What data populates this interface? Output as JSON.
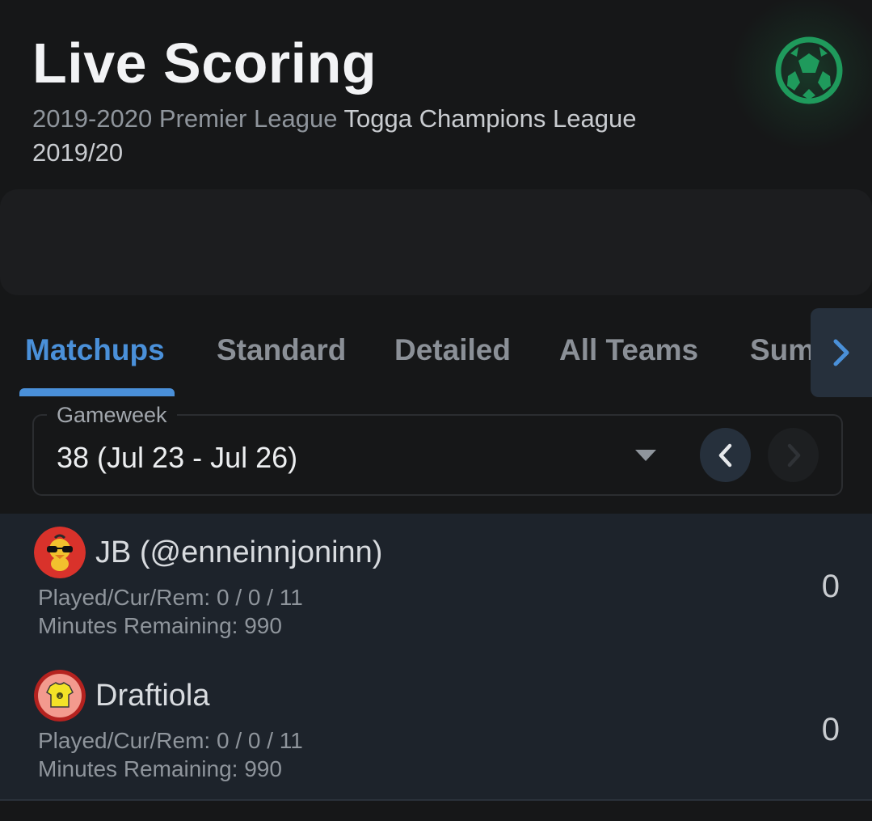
{
  "header": {
    "title": "Live Scoring",
    "season": "2019-2020 Premier League",
    "league": "Togga Champions League 2019/20",
    "icon": "soccer-ball-icon"
  },
  "tabs": {
    "items": [
      {
        "label": "Matchups",
        "active": true
      },
      {
        "label": "Standard",
        "active": false
      },
      {
        "label": "Detailed",
        "active": false
      },
      {
        "label": "All Teams",
        "active": false
      },
      {
        "label": "Summary",
        "active": false
      }
    ],
    "scroll_icon": "chevron-right-icon"
  },
  "gameweek": {
    "label": "Gameweek",
    "value": "38 (Jul 23 - Jul 26)",
    "prev_icon": "chevron-left-icon",
    "next_icon": "chevron-right-icon"
  },
  "matchup": {
    "teams": [
      {
        "name": "JB (@enneinnjoninn)",
        "played": "Played/Cur/Rem: 0 / 0 / 11",
        "minutes": "Minutes Remaining: 990",
        "score": "0",
        "avatar": "duck-sunglasses-avatar"
      },
      {
        "name": "Draftiola",
        "played": "Played/Cur/Rem: 0 / 0 / 11",
        "minutes": "Minutes Remaining: 990",
        "score": "0",
        "avatar": "yellow-jersey-avatar"
      }
    ]
  },
  "colors": {
    "accent": "#4a90d9",
    "ball_green": "#1f9a5c",
    "background": "#161718",
    "card": "#1d232b"
  }
}
